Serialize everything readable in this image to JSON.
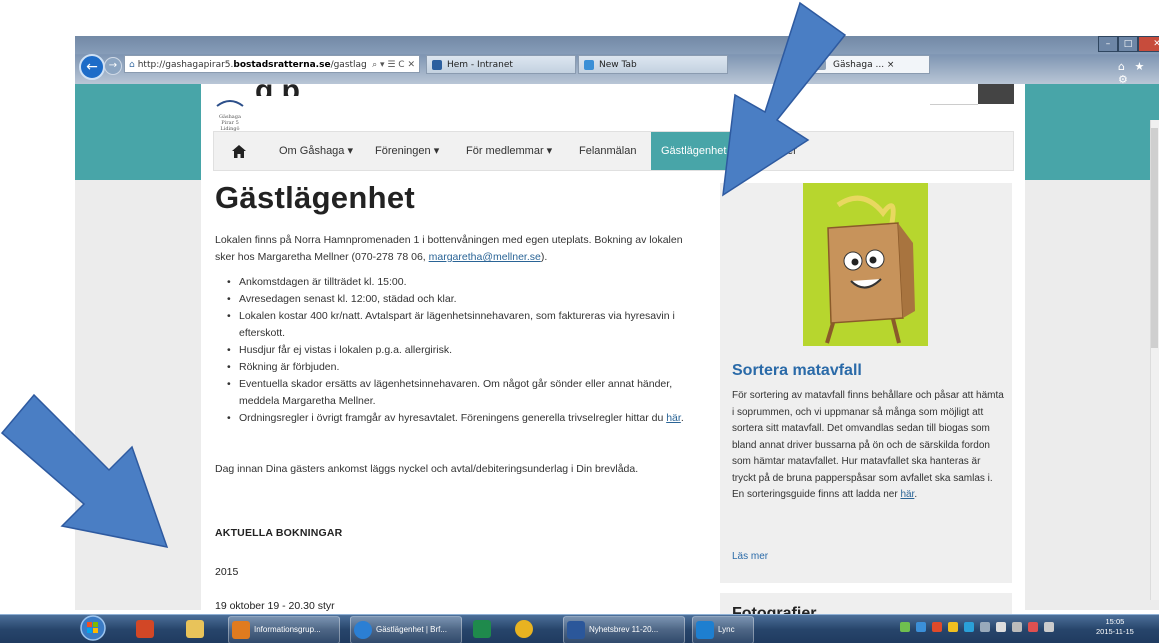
{
  "browser": {
    "url_prefix": "http://gashagapirar5.",
    "url_domain": "bostadsratterna.se",
    "url_suffix": "/gastlag",
    "url_controls": "⌕ ▾ ☰ C ✕",
    "tabs": [
      {
        "label": "Hem - Intranet"
      },
      {
        "label": "New Tab"
      },
      {
        "label": "Gäshaga ... ×"
      }
    ],
    "window_controls": {
      "minimize": "–",
      "maximize": "□",
      "close": "✕"
    },
    "toolbar_icons": "⌂ ★ ⚙"
  },
  "site": {
    "logo_text": "Gäshaga Pirar 5 Lidingö",
    "title_partial": "g  p"
  },
  "nav": {
    "home_icon": "house-icon",
    "items": [
      {
        "label": "Om Gåshaga ▾"
      },
      {
        "label": "Föreningen ▾"
      },
      {
        "label": "För medlemmar ▾"
      },
      {
        "label": "Felanmälan"
      },
      {
        "label": "Gästlägenhet"
      },
      {
        "label": "er"
      }
    ]
  },
  "content": {
    "heading": "Gästlägenhet",
    "intro_1": "Lokalen finns på Norra Hamnpromenaden 1 i bottenvåningen med egen uteplats. Bokning av lokalen sker hos Margaretha Mellner (070-278 78 06, ",
    "intro_email": "margaretha@mellner.se",
    "intro_2": ").",
    "bullets": [
      "Ankomstdagen är tillträdet kl. 15:00.",
      "Avresedagen senast kl. 12:00, städad och klar.",
      "Lokalen kostar 400 kr/natt. Avtalspart är lägenhetsinnehavaren, som faktureras via hyresavin i efterskott.",
      "Husdjur får ej vistas i lokalen p.g.a. allergirisk.",
      "Rökning är förbjuden.",
      "Eventuella skador ersätts av lägenhetsinnehavaren. Om något går sönder eller annat händer, meddela Margaretha Mellner."
    ],
    "bullet_last_text": "Ordningsregler i övrigt framgår av hyresavtalet. Föreningens generella trivselregler hittar du ",
    "bullet_last_link": "här",
    "bullet_last_end": ".",
    "after": "Dag innan Dina gästers ankomst läggs nyckel och avtal/debiteringsunderlag i Din brevlåda.",
    "bookings_heading": "AKTUELLA BOKNINGAR",
    "year": "2015",
    "booking_1": "19 oktober 19 - 20.30 styr"
  },
  "sidebar": {
    "heading": "Sortera matavfall",
    "text": "För sortering av matavfall finns behållare och påsar att hämta i soprummen, och vi uppmanar så många som möjligt att sortera sitt matavfall. Det omvandlas sedan till biogas som bland annat driver bussarna på ön och de särskilda fordon som hämtar matavfallet. Hur matavfallet ska hanteras är tryckt på de bruna papperspåsar som avfallet ska samlas i. En sorteringsguide finns att ladda ner ",
    "text_link": "här",
    "text_end": ".",
    "more": "Läs mer",
    "heading2": "Fotografier"
  },
  "taskbar": {
    "items": [
      {
        "label": "Informationsgrup..."
      },
      {
        "label": "Gästlägenhet | Brf..."
      },
      {
        "label": "Nyhetsbrev 11-20..."
      },
      {
        "label": "Lync"
      }
    ],
    "clock_time": "15:05",
    "clock_date": "2015-11-15"
  },
  "colors": {
    "teal": "#48a5a8",
    "link": "#2a6496",
    "arrow": "#4a7ec4",
    "image_bg": "#b7d62e"
  }
}
